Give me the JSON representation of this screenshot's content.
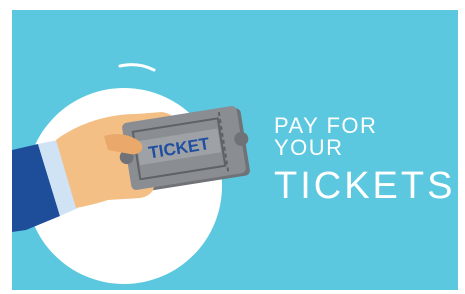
{
  "scene": {
    "background_color": "#5bc8e0",
    "circle_color": "#ffffff",
    "ticket_color": "#8a8d91",
    "ticket_dark_color": "#6f7276",
    "ticket_text_color": "#1f4fa0",
    "sleeve_color": "#1e4e9a",
    "skin_color": "#f4bf85"
  },
  "ticket": {
    "label": "TICKET"
  },
  "headline": {
    "line1": "PAY FOR YOUR",
    "line2": "TICKETS"
  }
}
